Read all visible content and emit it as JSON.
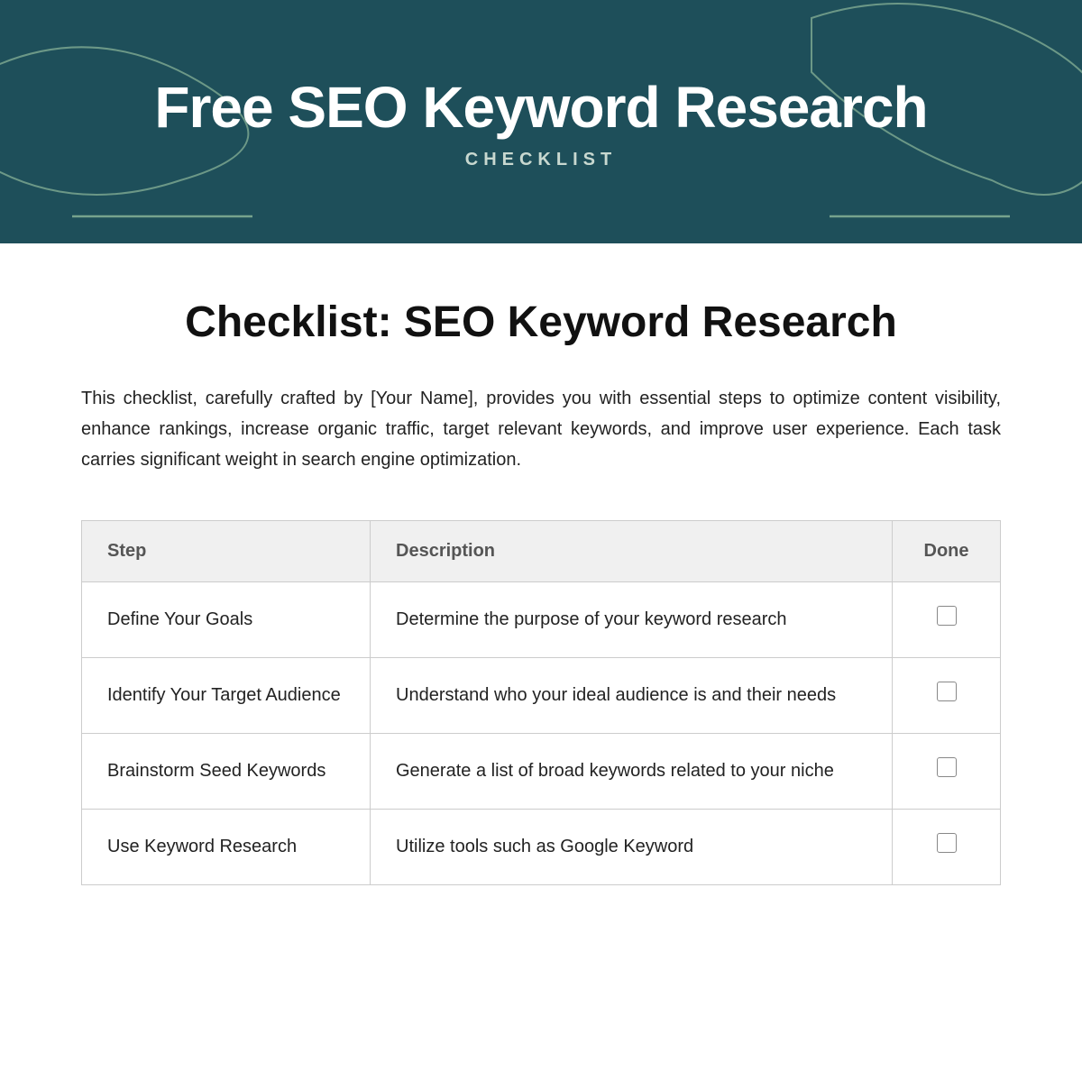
{
  "header": {
    "title": "Free SEO Keyword Research",
    "subtitle": "CHECKLIST",
    "bg_color": "#1e4f5a"
  },
  "page_title": "Checklist: SEO Keyword Research",
  "description": "This checklist, carefully crafted by [Your Name], provides you with essential steps to optimize content visibility, enhance rankings, increase organic traffic, target relevant keywords, and improve user experience. Each task carries significant weight in search engine optimization.",
  "table": {
    "headers": {
      "step": "Step",
      "description": "Description",
      "done": "Done"
    },
    "rows": [
      {
        "step": "Define Your Goals",
        "description": "Determine the purpose of your keyword research",
        "done": false
      },
      {
        "step": "Identify Your Target Audience",
        "description": "Understand who your ideal audience is and their needs",
        "done": false
      },
      {
        "step": "Brainstorm Seed Keywords",
        "description": "Generate a list of broad keywords related to your niche",
        "done": false
      },
      {
        "step": "Use Keyword Research",
        "description": "Utilize tools such as Google Keyword",
        "done": false
      }
    ]
  }
}
